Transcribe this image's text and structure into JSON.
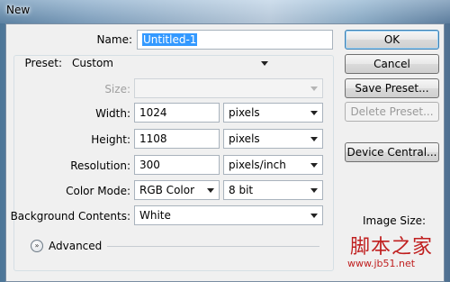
{
  "window": {
    "title": "New"
  },
  "form": {
    "name_label": "Name:",
    "name_value": "Untitled-1",
    "preset_label": "Preset:",
    "preset_value": "Custom",
    "size_label": "Size:",
    "size_value": "",
    "width_label": "Width:",
    "width_value": "1024",
    "width_unit": "pixels",
    "height_label": "Height:",
    "height_value": "1108",
    "height_unit": "pixels",
    "resolution_label": "Resolution:",
    "resolution_value": "300",
    "resolution_unit": "pixels/inch",
    "color_mode_label": "Color Mode:",
    "color_mode_value": "RGB Color",
    "bit_depth_value": "8 bit",
    "background_label": "Background Contents:",
    "background_value": "White",
    "advanced_label": "Advanced",
    "advanced_icon_glyph": "»"
  },
  "buttons": {
    "ok": "OK",
    "cancel": "Cancel",
    "save_preset": "Save Preset...",
    "delete_preset": "Delete Preset...",
    "device_central": "Device Central..."
  },
  "info": {
    "image_size_label": "Image Size:"
  },
  "watermark": {
    "text": "脚本之家",
    "url": "www.jb51.net"
  }
}
